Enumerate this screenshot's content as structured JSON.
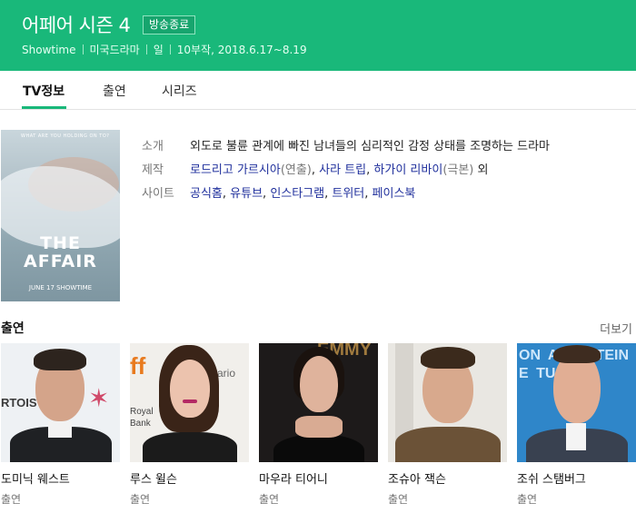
{
  "header": {
    "title": "어페어 시즌 4",
    "badge": "방송종료",
    "meta": [
      "Showtime",
      "미국드라마",
      "일",
      "10부작, 2018.6.17~8.19"
    ],
    "color": "#19b87a"
  },
  "tabs": [
    {
      "label": "TV정보",
      "active": true
    },
    {
      "label": "출연",
      "active": false
    },
    {
      "label": "시리즈",
      "active": false
    }
  ],
  "poster": {
    "top_text": "WHAT ARE YOU HOLDING ON TO?",
    "title_line1": "THE",
    "title_line2": "AFFAIR",
    "date": "JUNE 17  SHOWTIME"
  },
  "info": {
    "intro_label": "소개",
    "intro_text": "외도로 불륜 관계에 빠진 남녀들의 심리적인 감정 상태를 조명하는 드라마",
    "production_label": "제작",
    "production": {
      "director": "로드리고 가르시아",
      "director_role": "(연출)",
      "writer1": "사라 트립",
      "writer2": "하가이 리바이",
      "writer2_role": "(극본)",
      "suffix": " 외"
    },
    "site_label": "사이트",
    "sites": [
      "공식홈",
      "유튜브",
      "인스타그램",
      "트위터",
      "페이스북"
    ]
  },
  "cast": {
    "heading": "출연",
    "more": "더보기",
    "members": [
      {
        "name": "도미닉 웨스트",
        "role": "출연"
      },
      {
        "name": "루스 윌슨",
        "role": "출연"
      },
      {
        "name": "마우라 티어니",
        "role": "출연"
      },
      {
        "name": "조슈아 잭슨",
        "role": "출연"
      },
      {
        "name": "조쉬 스탬버그",
        "role": "출연"
      }
    ],
    "bg_text": {
      "card1": "RTOIS",
      "card2a": "ff",
      "card2b": "ario",
      "card2c": "Royal",
      "card2d": "Bank",
      "card3": "EMMY",
      "card5": "ON  A TIE  TEIN  E TUC"
    }
  }
}
